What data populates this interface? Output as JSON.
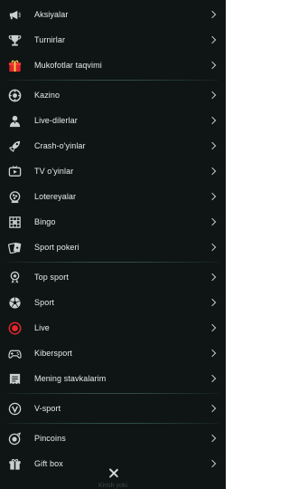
{
  "menu": {
    "group1": [
      {
        "label": "Aksiyalar",
        "icon": "megaphone-icon"
      },
      {
        "label": "Turnirlar",
        "icon": "trophy-icon"
      },
      {
        "label": "Mukofotlar taqvimi",
        "icon": "gift-calendar-icon"
      }
    ],
    "group2": [
      {
        "label": "Kazino",
        "icon": "casino-chip-icon"
      },
      {
        "label": "Live-dilerlar",
        "icon": "dealer-icon"
      },
      {
        "label": "Crash-o'yinlar",
        "icon": "rocket-icon"
      },
      {
        "label": "TV o'yinlar",
        "icon": "tv-icon"
      },
      {
        "label": "Lotereyalar",
        "icon": "lottery-icon"
      },
      {
        "label": "Bingo",
        "icon": "bingo-icon"
      },
      {
        "label": "Sport pokeri",
        "icon": "cards-icon"
      }
    ],
    "group3": [
      {
        "label": "Top sport",
        "icon": "top-sport-icon"
      },
      {
        "label": "Sport",
        "icon": "soccer-ball-icon"
      },
      {
        "label": "Live",
        "icon": "live-icon"
      },
      {
        "label": "Kibersport",
        "icon": "gamepad-icon"
      },
      {
        "label": "Mening stavkalarim",
        "icon": "my-bets-icon"
      }
    ],
    "group4": [
      {
        "label": "V-sport",
        "icon": "v-sport-icon"
      }
    ],
    "group5": [
      {
        "label": "Pincoins",
        "icon": "pincoins-icon"
      },
      {
        "label": "Gift box",
        "icon": "gift-box-icon"
      }
    ]
  },
  "colors": {
    "background": "#0f1514",
    "accent_red": "#e3262b",
    "separator": "#2f4d45"
  },
  "footer": {
    "close_icon": "close-icon",
    "hint": "Kirish yoki"
  }
}
